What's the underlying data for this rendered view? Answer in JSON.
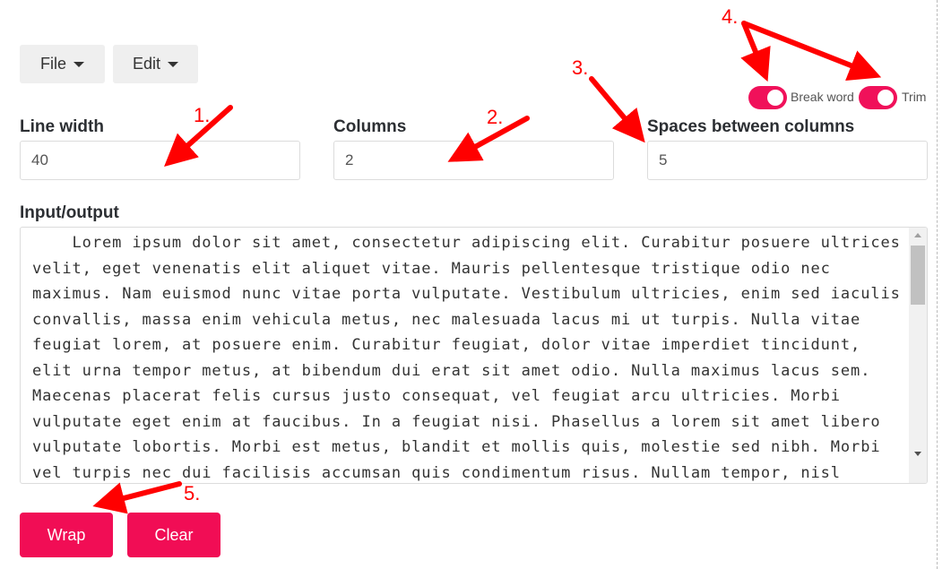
{
  "menu": {
    "file": "File",
    "edit": "Edit"
  },
  "toggles": {
    "break_word": {
      "label": "Break word",
      "on": true
    },
    "trim": {
      "label": "Trim",
      "on": true
    }
  },
  "fields": {
    "line_width": {
      "label": "Line width",
      "value": "40"
    },
    "columns": {
      "label": "Columns",
      "value": "2"
    },
    "spaces": {
      "label": "Spaces between columns",
      "value": "5"
    }
  },
  "io": {
    "label": "Input/output",
    "text": "    Lorem ipsum dolor sit amet, consectetur adipiscing elit. Curabitur posuere ultrices velit, eget venenatis elit aliquet vitae. Mauris pellentesque tristique odio nec maximus. Nam euismod nunc vitae porta vulputate. Vestibulum ultricies, enim sed iaculis convallis, massa enim vehicula metus, nec malesuada lacus mi ut turpis. Nulla vitae feugiat lorem, at posuere enim. Curabitur feugiat, dolor vitae imperdiet tincidunt, elit urna tempor metus, at bibendum dui erat sit amet odio. Nulla maximus lacus sem. Maecenas placerat felis cursus justo consequat, vel feugiat arcu ultricies. Morbi vulputate eget enim at faucibus. In a feugiat nisi. Phasellus a lorem sit amet libero vulputate lobortis. Morbi est metus, blandit et mollis quis, molestie sed nibh. Morbi vel turpis nec dui facilisis accumsan quis condimentum risus. Nullam tempor, nisl"
  },
  "actions": {
    "wrap": "Wrap",
    "clear": "Clear"
  },
  "annotations": [
    "1.",
    "2.",
    "3.",
    "4.",
    "5."
  ],
  "colors": {
    "accent": "#f10d55",
    "annotation": "#ff0000"
  }
}
